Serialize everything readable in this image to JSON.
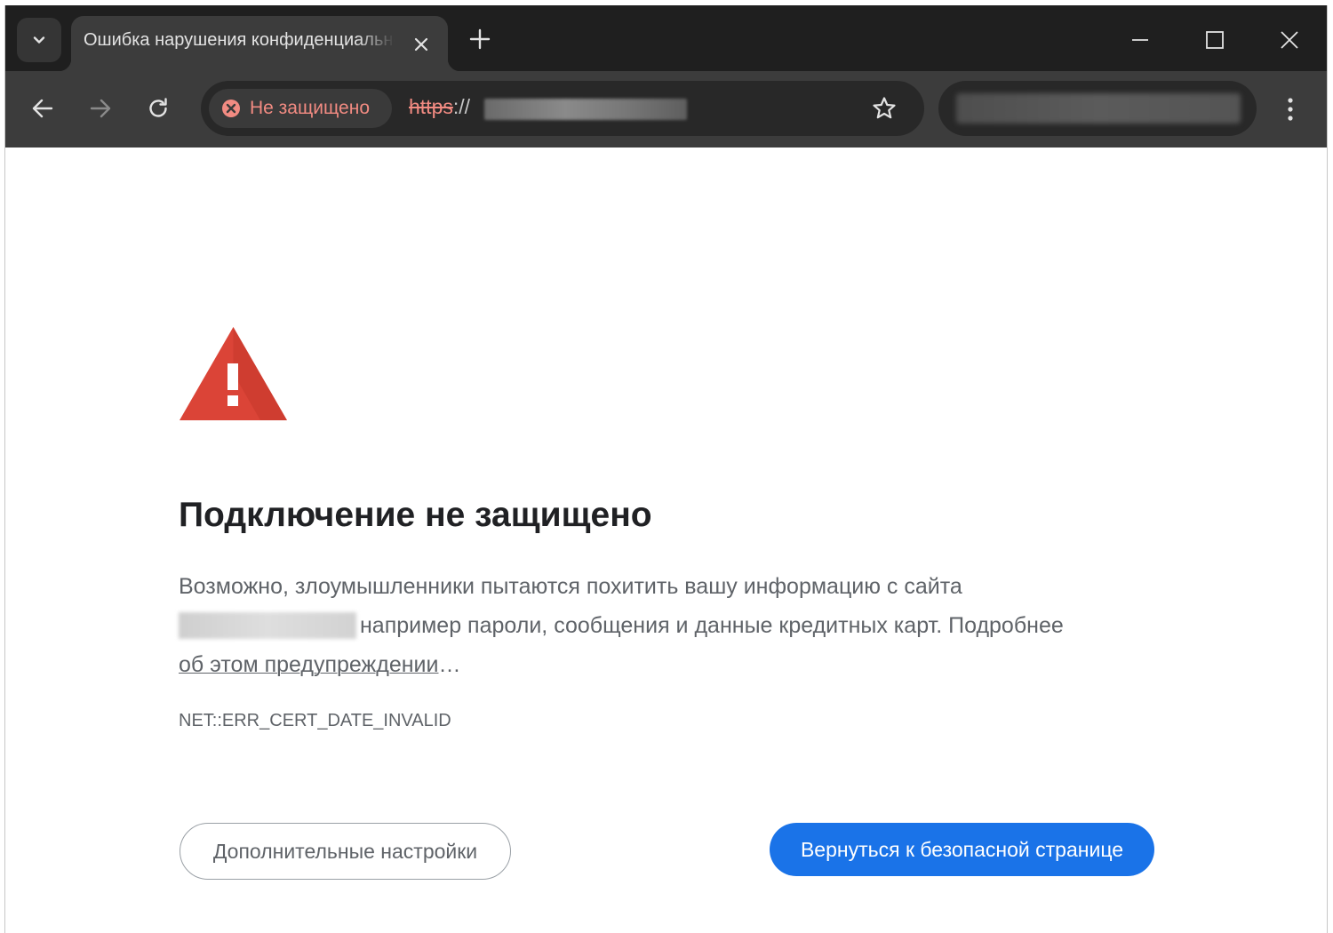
{
  "tab": {
    "title": "Ошибка нарушения конфиденциальности",
    "close_icon": "close-icon",
    "new_tab_icon": "plus-icon"
  },
  "window_controls": {
    "minimize_icon": "minimize-icon",
    "maximize_icon": "maximize-icon",
    "close_icon": "close-icon"
  },
  "toolbar": {
    "back_icon": "arrow-left-icon",
    "forward_icon": "arrow-right-icon",
    "reload_icon": "reload-icon",
    "security_chip": "Не защищено",
    "url_protocol": "https",
    "url_separator": "://",
    "bookmark_icon": "star-icon",
    "menu_icon": "kebab-menu-icon"
  },
  "page": {
    "heading": "Подключение не защищено",
    "body_line1": "Возможно, злоумышленники пытаются похитить вашу информацию с сайта",
    "body_line2": "например пароли, сообщения и данные кредитных карт. Подробнее",
    "learn_more": "об этом предупреждении",
    "ellipsis": "…",
    "error_code": "NET::ERR_CERT_DATE_INVALID",
    "advanced_button": "Дополнительные настройки",
    "back_button": "Вернуться к безопасной странице"
  },
  "colors": {
    "warning_red": "#db4437",
    "insecure_text": "#f28b82",
    "primary_button": "#1a73e8",
    "frame_dark": "#1f1f1f",
    "toolbar": "#3c3c3c"
  }
}
